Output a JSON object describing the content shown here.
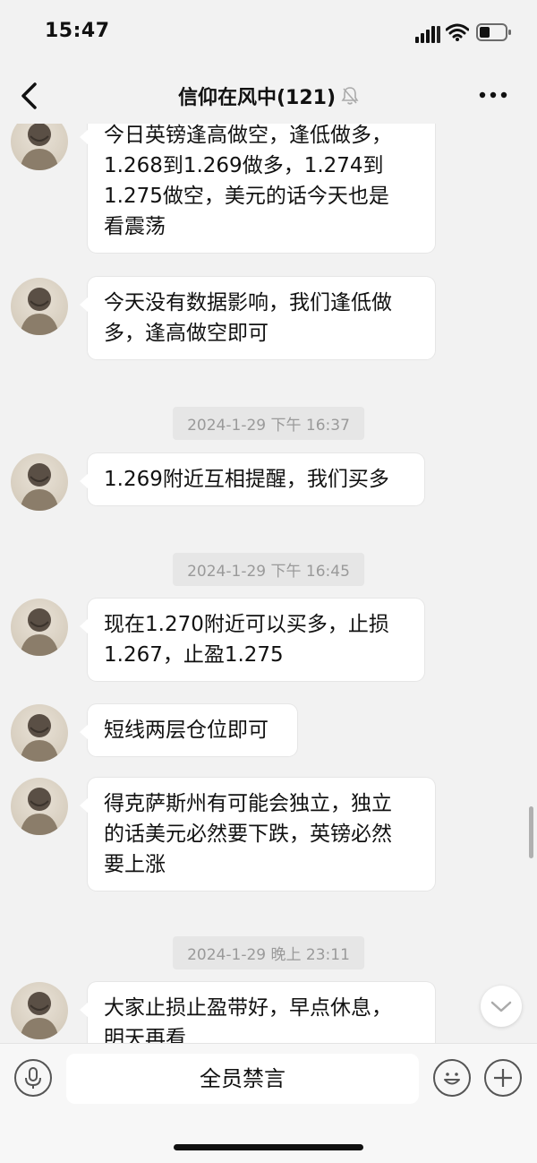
{
  "status_bar": {
    "time": "15:47"
  },
  "nav": {
    "title": "信仰在风中(121)"
  },
  "messages": [
    {
      "type": "text",
      "lines": [
        "今日英镑逢高做空，逢低做多，",
        "1.268到1.269做多，1.274到",
        "1.275做空，美元的话今天也是",
        "看震荡"
      ]
    },
    {
      "type": "text",
      "lines": [
        "今天没有数据影响，我们逢低做",
        "多，逢高做空即可"
      ]
    },
    {
      "type": "time",
      "text": "2024-1-29 下午 16:37"
    },
    {
      "type": "text",
      "lines": [
        "1.269附近互相提醒，我们买多"
      ]
    },
    {
      "type": "time",
      "text": "2024-1-29 下午 16:45"
    },
    {
      "type": "text",
      "lines": [
        "现在1.270附近可以买多，止损",
        "1.267，止盈1.275"
      ]
    },
    {
      "type": "text",
      "lines": [
        "短线两层仓位即可"
      ]
    },
    {
      "type": "text",
      "lines": [
        "得克萨斯州有可能会独立，独立",
        "的话美元必然要下跌，英镑必然",
        "要上涨"
      ]
    },
    {
      "type": "time",
      "text": "2024-1-29 晚上 23:11"
    },
    {
      "type": "text",
      "lines": [
        "大家止损止盈带好，早点休息，",
        "明天再看"
      ]
    }
  ],
  "input_bar": {
    "label": "全员禁言"
  },
  "icons": {
    "back": "chevron-left-icon",
    "bell": "muted-bell-icon",
    "more": "more-dots-icon",
    "voice": "microphone-icon",
    "emoji": "emoji-icon",
    "add": "plus-icon",
    "scroll": "chevron-down-icon"
  },
  "colors": {
    "background": "#f2f2f2",
    "bubble": "#ffffff",
    "timestamp_bg": "#e6e6e6",
    "timestamp_text": "#9a9a9a"
  }
}
